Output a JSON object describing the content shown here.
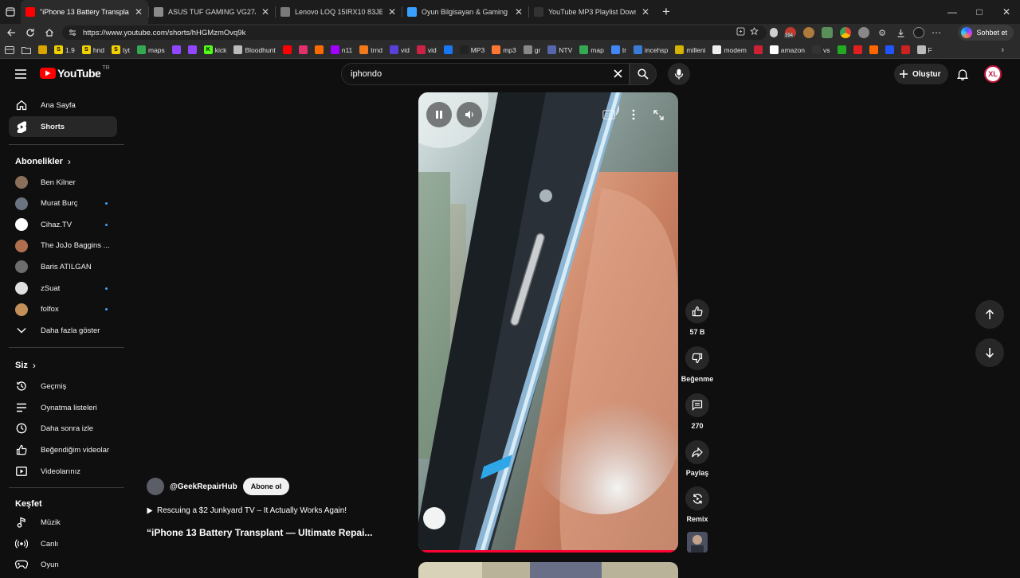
{
  "browser": {
    "tabs": [
      {
        "title": "\"iPhone 13 Battery Transplant",
        "favicon_color": "#ff0000",
        "active": true
      },
      {
        "title": "ASUS TUF GAMING VG27AQ3A 27",
        "favicon_color": "#8a8a8a",
        "active": false
      },
      {
        "title": "Lenovo LOQ 15IRX10 83JE00JMT",
        "favicon_color": "#7a7a7a",
        "active": false
      },
      {
        "title": "Oyun Bilgisayarı & Gaming PC Fiy",
        "favicon_color": "#3aa0ff",
        "active": false
      },
      {
        "title": "YouTube MP3 Playlist Downloader",
        "favicon_color": "#333333",
        "active": false
      }
    ],
    "url": "https://www.youtube.com/shorts/hHGMzmOvq9k",
    "copilot_label": "Sohbet et",
    "ext_badge": "394",
    "bookmarks": [
      {
        "label": "",
        "color": "#d9a300"
      },
      {
        "label": "1.9",
        "color": "#f0d000",
        "letter": "S"
      },
      {
        "label": "hnd",
        "color": "#f0d000",
        "letter": "S"
      },
      {
        "label": "tyt",
        "color": "#f0d000",
        "letter": "S"
      },
      {
        "label": "maps",
        "color": "#34a853"
      },
      {
        "label": "",
        "color": "#9146ff"
      },
      {
        "label": "",
        "color": "#9146ff"
      },
      {
        "label": "kick",
        "color": "#53fc18",
        "letter": "K"
      },
      {
        "label": "Bloodhunt",
        "color": "#bbbbbb"
      },
      {
        "label": "",
        "color": "#ff0000"
      },
      {
        "label": "",
        "color": "#e1306c"
      },
      {
        "label": "",
        "color": "#ff6a00"
      },
      {
        "label": "n11",
        "color": "#a200ff"
      },
      {
        "label": "trnd",
        "color": "#f27a1a"
      },
      {
        "label": "vid",
        "color": "#5b3fd9"
      },
      {
        "label": "vid",
        "color": "#cc2244"
      },
      {
        "label": "",
        "color": "#1877f2"
      },
      {
        "label": "MP3",
        "color": "#222222"
      },
      {
        "label": "mp3",
        "color": "#ff7733"
      },
      {
        "label": "gr",
        "color": "#888888"
      },
      {
        "label": "NTV",
        "color": "#5566aa"
      },
      {
        "label": "map",
        "color": "#34a853"
      },
      {
        "label": "tr",
        "color": "#4285f4"
      },
      {
        "label": "incehsp",
        "color": "#3a7bd5"
      },
      {
        "label": "milleni",
        "color": "#d4b400"
      },
      {
        "label": "modem",
        "color": "#eeeeee"
      },
      {
        "label": "",
        "color": "#cc2233"
      },
      {
        "label": "amazon",
        "color": "#ffffff"
      },
      {
        "label": "vs",
        "color": "#333333"
      },
      {
        "label": "",
        "color": "#22aa22"
      },
      {
        "label": "",
        "color": "#e02020"
      },
      {
        "label": "",
        "color": "#ff6600"
      },
      {
        "label": "",
        "color": "#2255ff"
      },
      {
        "label": "",
        "color": "#cc2222"
      },
      {
        "label": "F",
        "color": "#bbbbbb"
      }
    ]
  },
  "youtube": {
    "logo_text": "YouTube",
    "country_code": "TR",
    "search_value": "iphondo",
    "create_label": "Oluştur",
    "avatar_initials": "XL"
  },
  "sidebar": {
    "main": [
      {
        "label": "Ana Sayfa",
        "icon": "home-icon"
      },
      {
        "label": "Shorts",
        "icon": "shorts-icon",
        "active": true
      }
    ],
    "subs_heading": "Abonelikler",
    "subs": [
      {
        "name": "Ben Kilner",
        "color": "#8a6f5a",
        "dot": false
      },
      {
        "name": "Murat Burç",
        "color": "#6a7480",
        "dot": true
      },
      {
        "name": "Cihaz.TV",
        "color": "#ffffff",
        "dot": true
      },
      {
        "name": "The JoJo Baggins ...",
        "color": "#b07050",
        "dot": false
      },
      {
        "name": "Baris ATILGAN",
        "color": "#6d6d6d",
        "dot": false
      },
      {
        "name": "zSuat",
        "color": "#e0e0e0",
        "dot": true
      },
      {
        "name": "folfox",
        "color": "#c4905a",
        "dot": true
      }
    ],
    "show_more": "Daha fazla göster",
    "you_heading": "Siz",
    "you": [
      {
        "label": "Geçmiş",
        "icon": "history-icon"
      },
      {
        "label": "Oynatma listeleri",
        "icon": "playlist-icon"
      },
      {
        "label": "Daha sonra izle",
        "icon": "clock-icon"
      },
      {
        "label": "Beğendiğim videolar",
        "icon": "like-icon"
      },
      {
        "label": "Videolarınız",
        "icon": "your-videos-icon"
      }
    ],
    "explore_heading": "Keşfet",
    "explore": [
      {
        "label": "Müzik",
        "icon": "music-icon"
      },
      {
        "label": "Canlı",
        "icon": "live-icon"
      },
      {
        "label": "Oyun",
        "icon": "gaming-icon"
      }
    ]
  },
  "short": {
    "channel": "@GeekRepairHub",
    "subscribe_label": "Abone ol",
    "related_video": "Rescuing a $2 Junkyard TV – It Actually Works Again!",
    "title": "“iPhone 13 Battery Transplant — Ultimate Repai...",
    "likes": "57 B",
    "dislike_label": "Beğenme",
    "comments": "270",
    "share_label": "Paylaş",
    "remix_label": "Remix"
  }
}
